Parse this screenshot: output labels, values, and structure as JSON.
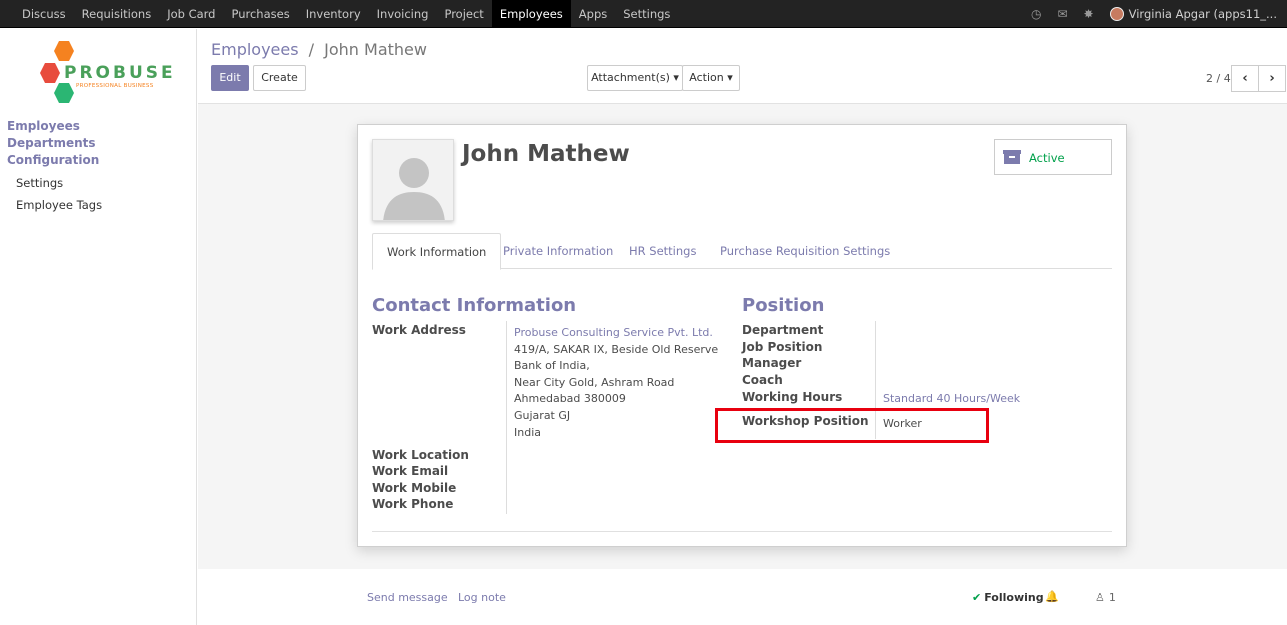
{
  "nav": {
    "menu": [
      "Discuss",
      "Requisitions",
      "Job Card",
      "Purchases",
      "Inventory",
      "Invoicing",
      "Project",
      "Employees",
      "Apps",
      "Settings"
    ],
    "active": "Employees",
    "user": "Virginia Apgar (apps11_..."
  },
  "logo": {
    "brand": "PROBUSE",
    "tagline": "PROFESSIONAL BUSINESS"
  },
  "sidebar": {
    "sections": [
      "Employees",
      "Departments",
      "Configuration"
    ],
    "items": [
      "Settings",
      "Employee Tags"
    ]
  },
  "breadcrumb": {
    "parent": "Employees",
    "separator": "/",
    "current": "John Mathew"
  },
  "buttons": {
    "edit": "Edit",
    "create": "Create",
    "attachments": "Attachment(s) ▾",
    "action": "Action ▾"
  },
  "pager": {
    "value": "2 / 4"
  },
  "employee": {
    "name": "John Mathew",
    "status": "Active",
    "tabs": [
      "Work Information",
      "Private Information",
      "HR Settings",
      "Purchase Requisition Settings"
    ],
    "contact": {
      "title": "Contact Information",
      "work_address_label": "Work Address",
      "address_company": "Probuse Consulting Service Pvt. Ltd.",
      "address_lines": [
        "419/A, SAKAR IX, Beside Old Reserve",
        "Bank of India,",
        "Near City Gold, Ashram Road",
        "Ahmedabad 380009",
        "Gujarat GJ",
        "India"
      ],
      "labels": [
        "Work Location",
        "Work Email",
        "Work Mobile",
        "Work Phone"
      ]
    },
    "position": {
      "title": "Position",
      "labels": [
        "Department",
        "Job Position",
        "Manager",
        "Coach",
        "Working Hours"
      ],
      "working_hours": "Standard 40 Hours/Week",
      "workshop_label": "Workshop Position",
      "workshop_value": "Worker"
    }
  },
  "chatter": {
    "send_message": "Send message",
    "log_note": "Log note",
    "following": "Following",
    "followers": "1"
  },
  "colors": {
    "accent": "#7c7bad",
    "navbar": "#232323",
    "highlight": "#e8000f",
    "active_status": "#00a04a"
  }
}
